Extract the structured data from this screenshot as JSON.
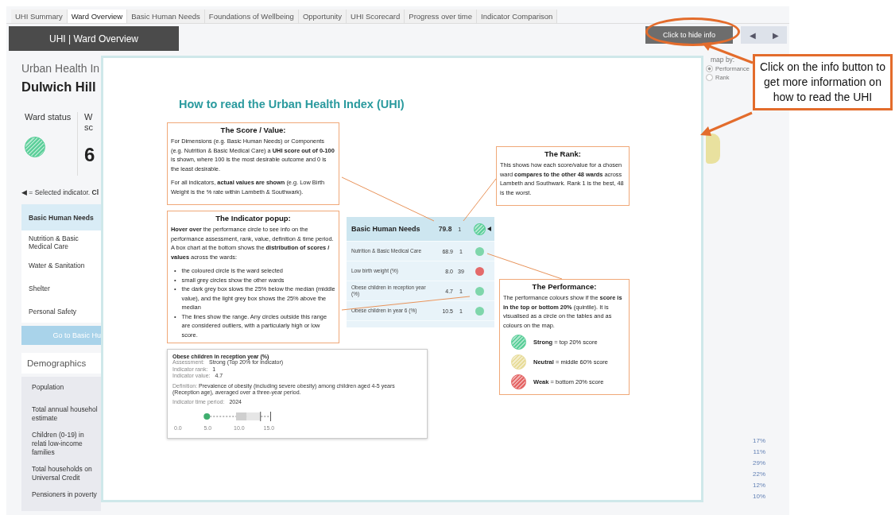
{
  "tabs": [
    {
      "label": "UHI Summary",
      "selected": false
    },
    {
      "label": "Ward Overview",
      "selected": true
    },
    {
      "label": "Basic Human Needs",
      "selected": false
    },
    {
      "label": "Foundations of Wellbeing",
      "selected": false
    },
    {
      "label": "Opportunity",
      "selected": false
    },
    {
      "label": "UHI Scorecard",
      "selected": false
    },
    {
      "label": "Progress over time",
      "selected": false
    },
    {
      "label": "Indicator Comparison",
      "selected": false
    }
  ],
  "page_title": "UHI | Ward Overview",
  "info_button": "Click to hide info",
  "nav_buttons": [
    "◀",
    "▶"
  ],
  "left": {
    "heading": "Urban Health In",
    "ward": "Dulwich Hill",
    "status_label": "Ward status",
    "status_circle": {
      "color": "#5ccf9a"
    },
    "score_label": "W sc",
    "score": "6",
    "legend": "◀ = Selected indicator. **Cl**",
    "items": [
      {
        "label": "Basic Human Needs",
        "selected": true
      },
      {
        "label": "Nutrition & Basic Medical Care",
        "selected": false
      },
      {
        "label": "Water & Sanitation",
        "selected": false
      },
      {
        "label": "Shelter",
        "selected": false
      },
      {
        "label": "Personal Safety",
        "selected": false
      }
    ],
    "go_button": "Go to Basic Hu",
    "demographics_title": "Demographics",
    "demographics": [
      "Population",
      "Total annual househol estimate",
      "Children (0-19) in relati low-income families",
      "Total households on Universal Credit",
      "Pensioners in poverty"
    ]
  },
  "right": {
    "map_by": "map by:",
    "radios": [
      {
        "label": "Performance",
        "selected": true
      },
      {
        "label": "Rank",
        "selected": false
      }
    ],
    "percentages": [
      "17%",
      "11%",
      "29%",
      "22%",
      "12%",
      "10%"
    ]
  },
  "guide": {
    "title": "How to read the Urban Health Index (UHI)",
    "score_box": {
      "title": "The Score / Value:",
      "paragraphs": [
        "For Dimensions (e.g. Basic Human Needs) or Components (e.g. Nutrition & Basic Medical Care) a **UHI score out of 0-100** is shown, where 100 is the most desirable outcome and 0 is the least desirable.",
        "For all indicators, **actual values are shown** (e.g. Low Birth Weight is the % rate within Lambeth & Southwark)."
      ]
    },
    "popup_box": {
      "title": "The Indicator popup:",
      "text": "**Hover over** the performance circle to see info on the performance assessment, rank, value, definition & time period. A box chart at the bottom shows the **distribution of scores / values** across the wards:",
      "bullet_mark": "•",
      "bullets": [
        "the coloured circle is the ward selected",
        "small grey circles show the other wards",
        "the dark grey box slows the 25% below the median (middle value), and the light grey box shows the 25% above the median",
        "The lines show the range. Any circles outside this range are considered outliers, with a particularly high or low score."
      ]
    },
    "popup_example": {
      "title": "Obese children in reception year (%)",
      "fields": [
        {
          "label": "Assessment:",
          "value": "Strong (Top 20% for indicator)"
        },
        {
          "label": "Indicator rank:",
          "value": "1"
        },
        {
          "label": "Indicator value:",
          "value": "4.7"
        }
      ],
      "definition_label": "Definition:",
      "definition": "Prevalence of obesity (including severe obesity) among children aged 4-5 years (Reception age), averaged over a three-year period.",
      "period_label": "Indicator time period:",
      "period": "2024",
      "axis_ticks": [
        "0.0",
        "5.0",
        "10.0",
        "15.0"
      ]
    },
    "table": [
      {
        "kind": "dimension",
        "label": "Basic Human Needs",
        "score": "79.8",
        "rank": "1",
        "color": "#5ccf9a",
        "selected": true
      },
      {
        "kind": "component",
        "label": "Nutrition & Basic Medical Care",
        "score": "68.9",
        "rank": "1",
        "color": "#7fd6ab",
        "selected": false
      },
      {
        "kind": "indicator",
        "label": "Low birth weight (%)",
        "score": "8.0",
        "rank": "39",
        "color": "#e46a6a",
        "selected": false
      },
      {
        "kind": "indicator",
        "label": "Obese children in reception year (%)",
        "score": "4.7",
        "rank": "1",
        "color": "#7fd6ab",
        "selected": false
      },
      {
        "kind": "indicator",
        "label": "Obese children in year 6 (%)",
        "score": "10.5",
        "rank": "1",
        "color": "#7fd6ab",
        "selected": false
      }
    ],
    "rank_box": {
      "title": "The Rank:",
      "text": "This shows how each score/value for a chosen ward **compares to the other 48 wards** across Lambeth and Southwark. Rank 1 is the best, 48 is the worst."
    },
    "performance_box": {
      "title": "The Performance:",
      "text": "The performance colours show if the **score is in the top or bottom 20%** (quintile). It is visualised as a circle on the tables and as colours on the map.",
      "legend": [
        {
          "label": "**Strong** = top 20% score",
          "color": "#5ccf9a"
        },
        {
          "label": "**Neutral** = middle  60% score",
          "color": "#e8dc9a"
        },
        {
          "label": "**Weak** = bottom 20% score",
          "color": "#e46464"
        }
      ]
    }
  },
  "callout": "Click on the info button to get more information on how to read the UHI"
}
